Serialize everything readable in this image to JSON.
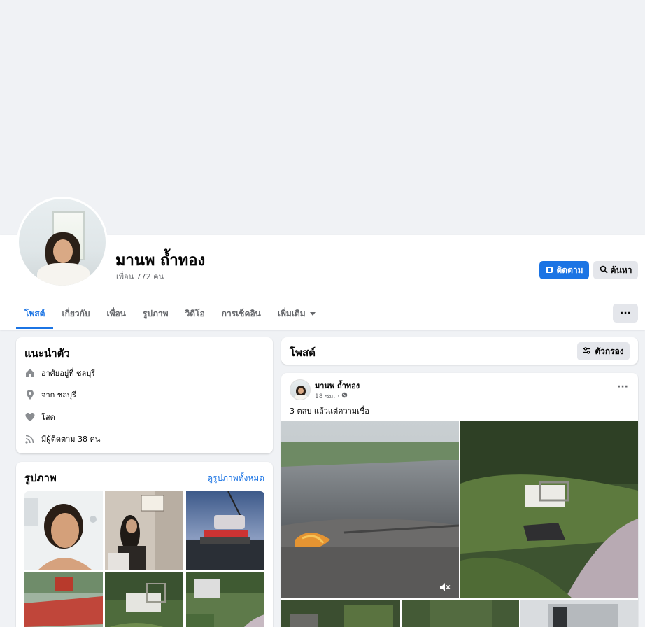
{
  "profile": {
    "name": "มานพ ถ้ำทอง",
    "friends": "เพื่อน 772 คน"
  },
  "actions": {
    "follow_label": "ติดตาม",
    "search_label": "ค้นหา",
    "more_label": "···"
  },
  "tabs": [
    {
      "label": "โพสต์",
      "active": true
    },
    {
      "label": "เกี่ยวกับ",
      "active": false
    },
    {
      "label": "เพื่อน",
      "active": false
    },
    {
      "label": "รูปภาพ",
      "active": false
    },
    {
      "label": "วิดีโอ",
      "active": false
    },
    {
      "label": "การเช็คอิน",
      "active": false
    },
    {
      "label": "เพิ่มเติม",
      "active": false
    }
  ],
  "intro": {
    "title": "แนะนำตัว",
    "items": [
      {
        "icon": "home-icon",
        "text": "อาศัยอยู่ที่ ชลบุรี"
      },
      {
        "icon": "location-pin-icon",
        "text": "จาก ชลบุรี"
      },
      {
        "icon": "heart-icon",
        "text": "โสด"
      },
      {
        "icon": "rss-icon",
        "text": "มีผู้ติดตาม 38 คน"
      }
    ]
  },
  "photos": {
    "title": "รูปภาพ",
    "see_all": "ดูรูปภาพทั้งหมด"
  },
  "posts_header": {
    "title": "โพสต์",
    "filter_label": "ตัวกรอง"
  },
  "post": {
    "author": "มานพ ถ้ำทอง",
    "time": "18 ชม. ·",
    "text": "3 ตลบ แล้วแต่ความเชื่อ"
  },
  "colors": {
    "accent": "#1b74e4",
    "background": "#f0f2f5",
    "secondary_text": "#65676b"
  }
}
